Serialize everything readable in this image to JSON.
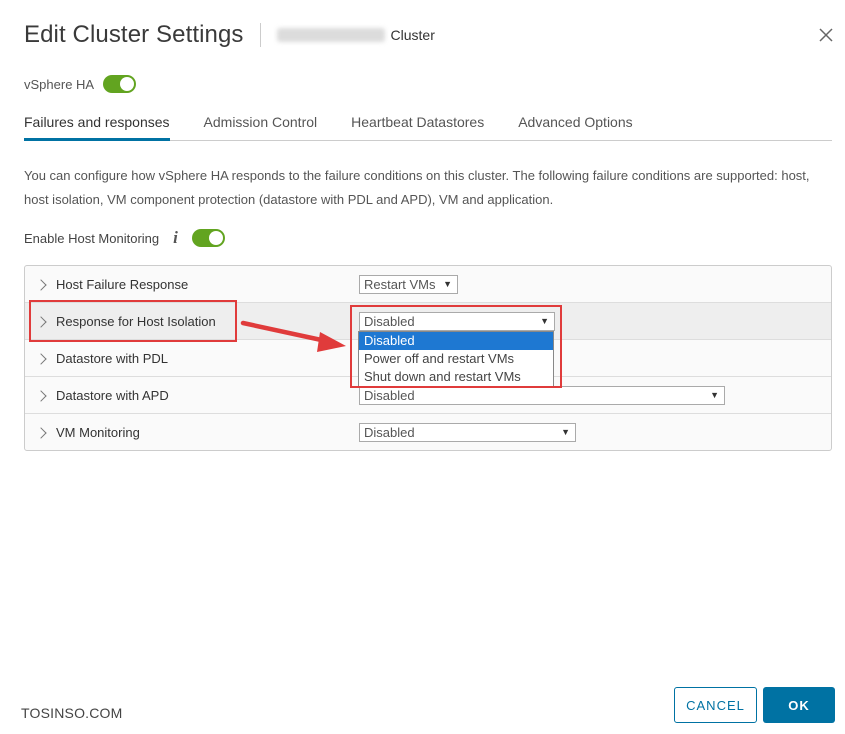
{
  "dialog": {
    "title": "Edit Cluster Settings",
    "cluster_suffix": "Cluster",
    "close_icon": "close-icon"
  },
  "vsphere_ha": {
    "label": "vSphere HA",
    "enabled": true
  },
  "tabs": [
    {
      "label": "Failures and responses",
      "active": true
    },
    {
      "label": "Admission Control",
      "active": false
    },
    {
      "label": "Heartbeat Datastores",
      "active": false
    },
    {
      "label": "Advanced Options",
      "active": false
    }
  ],
  "description": "You can configure how vSphere HA responds to the failure conditions on this cluster. The following failure conditions are supported: host, host isolation, VM component protection (datastore with PDL and APD), VM and application.",
  "host_monitoring": {
    "label": "Enable Host Monitoring",
    "info_icon": "info-icon",
    "enabled": true
  },
  "rows": [
    {
      "label": "Host Failure Response",
      "value": "Restart VMs"
    },
    {
      "label": "Response for Host Isolation",
      "value": "Disabled"
    },
    {
      "label": "Datastore with PDL",
      "value": ""
    },
    {
      "label": "Datastore with APD",
      "value": "Disabled"
    },
    {
      "label": "VM Monitoring",
      "value": "Disabled"
    }
  ],
  "isolation_dropdown_options": [
    {
      "label": "Disabled",
      "selected": true
    },
    {
      "label": "Power off and restart VMs",
      "selected": false
    },
    {
      "label": "Shut down and restart VMs",
      "selected": false
    }
  ],
  "watermark": "TOSINSO.COM",
  "buttons": {
    "cancel": "CANCEL",
    "ok": "OK"
  },
  "colors": {
    "accent": "#0072a3",
    "toggle_on": "#62a420",
    "annotation_red": "#e03b3b",
    "option_highlight": "#1e78d2"
  }
}
